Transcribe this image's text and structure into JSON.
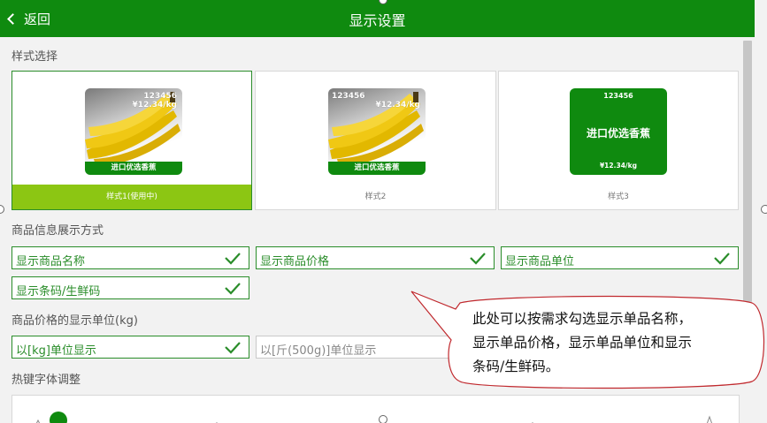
{
  "header": {
    "back_label": "返回",
    "title": "显示设置"
  },
  "sections": {
    "style_select": "样式选择",
    "info_display": "商品信息展示方式",
    "price_unit": "商品价格的显示单位(kg)",
    "hotkey_font": "热键字体调整"
  },
  "style_cards": [
    {
      "caption": "样式1(使用中)",
      "code": "123456",
      "price": "¥12.34/kg",
      "name": "进口优选香蕉",
      "selected": true
    },
    {
      "caption": "样式2",
      "code": "123456",
      "price": "¥12.34/kg",
      "name": "进口优选香蕉",
      "selected": false
    },
    {
      "caption": "样式3",
      "code": "123456",
      "price": "¥12.34/kg",
      "name": "进口优选香蕉",
      "selected": false
    }
  ],
  "info_options": [
    {
      "label": "显示商品名称",
      "checked": true
    },
    {
      "label": "显示商品价格",
      "checked": true
    },
    {
      "label": "显示商品单位",
      "checked": true
    },
    {
      "label": "显示条码/生鲜码",
      "checked": true
    }
  ],
  "unit_options": [
    {
      "label": "以[kg]单位显示",
      "checked": true
    },
    {
      "label": "以[斤(500g)]单位显示",
      "checked": false
    }
  ],
  "callout": {
    "line1": "此处可以按需求勾选显示单品名称，",
    "line2": "显示单品价格，显示单品单位和显示",
    "line3": "条码/生鲜码。"
  },
  "colors": {
    "primary": "#0f8a0f",
    "selected_caption": "#8cc613",
    "callout_border": "#c0282d"
  },
  "icons": [
    "chevron-left-icon",
    "checkmark-icon",
    "slider-knob"
  ]
}
